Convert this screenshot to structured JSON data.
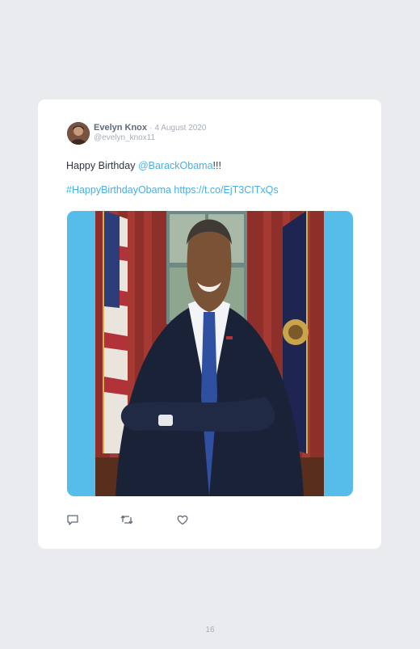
{
  "tweet": {
    "author_name": "Evelyn Knox",
    "separator": "·",
    "date": "4 August 2020",
    "handle": "@evelyn_knox11",
    "text_prefix": "Happy Birthday ",
    "mention": "@BarackObama",
    "text_suffix": "!!!",
    "hashtag": "#HappyBirthdayObama",
    "url": "https://t.co/EjT3CITxQs",
    "media_alt": "Official portrait of Barack Obama",
    "actions": [
      {
        "name": "reply",
        "icon": "comment-icon"
      },
      {
        "name": "retweet",
        "icon": "retweet-icon"
      },
      {
        "name": "like",
        "icon": "heart-icon"
      }
    ]
  },
  "page": {
    "number": "16"
  },
  "colors": {
    "background": "#e9ebee",
    "card": "#ffffff",
    "link": "#4aaee0",
    "media_background": "#56bdea",
    "name": "#5e6a7a",
    "muted": "#a6aeb8"
  }
}
